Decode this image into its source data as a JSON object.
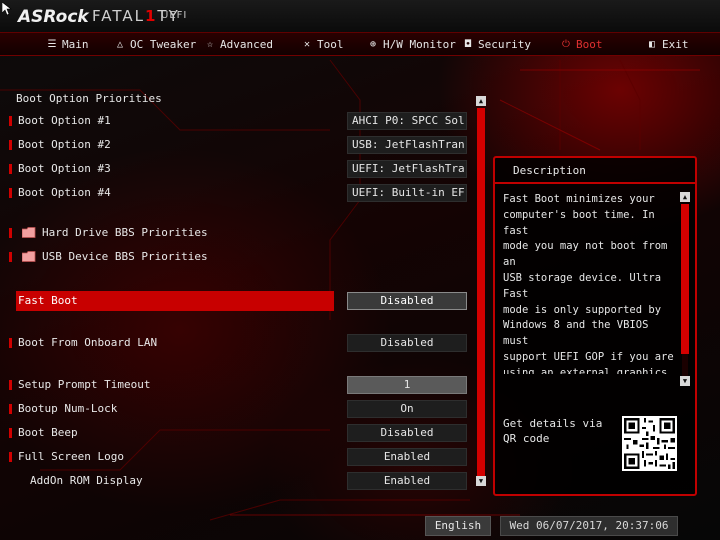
{
  "brand": {
    "name": "ASRock",
    "series_pre": "FATAL",
    "series_accent": "1",
    "series_post": "TY",
    "suffix": "UEFI"
  },
  "nav": {
    "tabs": [
      {
        "label": "Main",
        "icon": "list-icon"
      },
      {
        "label": "OC Tweaker",
        "icon": "flame-icon"
      },
      {
        "label": "Advanced",
        "icon": "star-icon"
      },
      {
        "label": "Tool",
        "icon": "wrench-icon"
      },
      {
        "label": "H/W Monitor",
        "icon": "monitor-icon"
      },
      {
        "label": "Security",
        "icon": "shield-icon"
      },
      {
        "label": "Boot",
        "icon": "power-icon",
        "active": true
      },
      {
        "label": "Exit",
        "icon": "exit-door-icon"
      }
    ]
  },
  "main": {
    "section_title": "Boot Option Priorities",
    "boot_options": [
      {
        "label": "Boot Option #1",
        "value": "AHCI P0: SPCC Sol..."
      },
      {
        "label": "Boot Option #2",
        "value": "USB: JetFlashTran..."
      },
      {
        "label": "Boot Option #3",
        "value": "UEFI: JetFlashTra..."
      },
      {
        "label": "Boot Option #4",
        "value": "UEFI: Built-in EF..."
      }
    ],
    "folders": [
      {
        "label": "Hard Drive BBS Priorities"
      },
      {
        "label": "USB Device BBS Priorities"
      }
    ],
    "fast_boot": {
      "label": "Fast Boot",
      "value": "Disabled"
    },
    "onboard_lan": {
      "label": "Boot From Onboard LAN",
      "value": "Disabled"
    },
    "settings": [
      {
        "label": "Setup Prompt Timeout",
        "value": "1"
      },
      {
        "label": "Bootup Num-Lock",
        "value": "On"
      },
      {
        "label": "Boot Beep",
        "value": "Disabled"
      },
      {
        "label": "Full Screen Logo",
        "value": "Enabled"
      },
      {
        "label": "AddOn ROM Display",
        "value": "Enabled"
      }
    ]
  },
  "description": {
    "title": "Description",
    "text": "Fast Boot minimizes your\ncomputer's boot time. In fast\nmode you may not boot from an\nUSB storage device. Ultra Fast\nmode is only supported by\nWindows 8 and the VBIOS must\nsupport UEFI GOP if you are\nusing an external graphics\ncard. Please notice that Ultra\nFast mode will boot so fast\nthat the only way to enter\nthis UEFI Setup Utility is to",
    "qr_label": "Get details via QR code"
  },
  "footer": {
    "language": "English",
    "datetime": "Wed 06/07/2017, 20:37:06"
  },
  "colors": {
    "accent": "#d00000",
    "highlight": "#c80000",
    "text": "#e8e8e8"
  }
}
